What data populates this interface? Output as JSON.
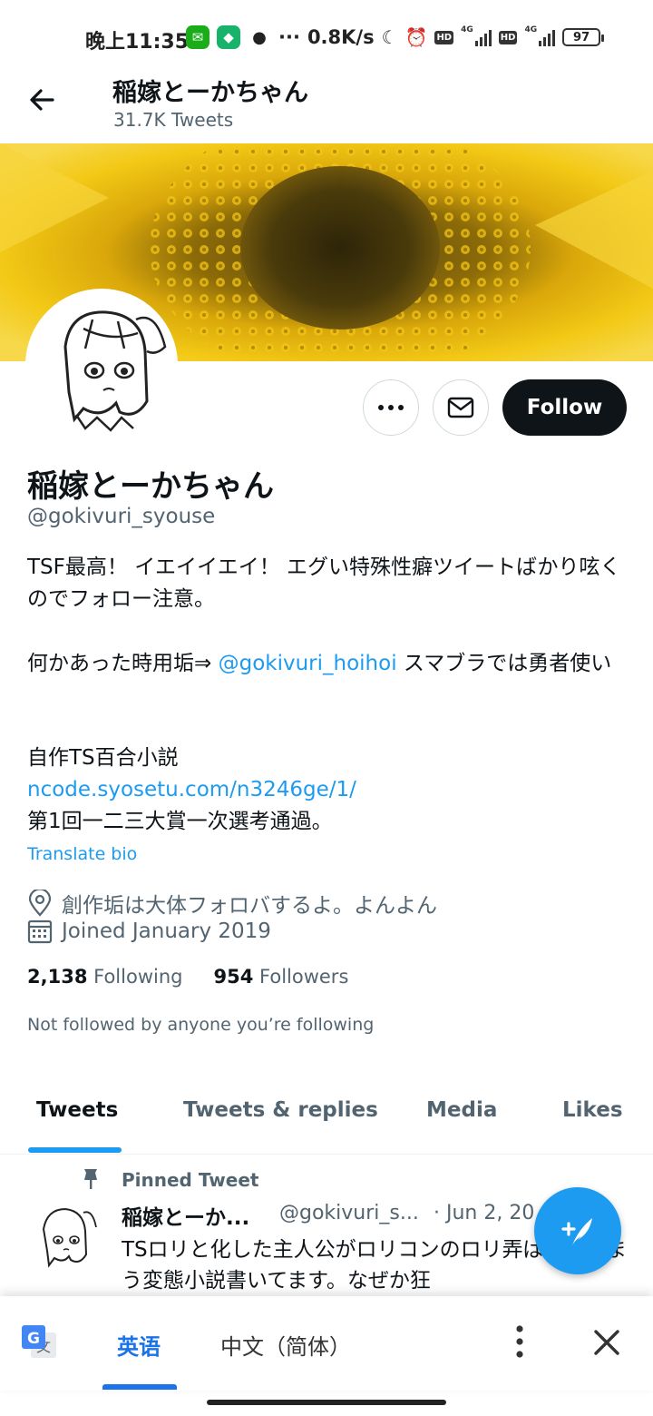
{
  "status_bar": {
    "time": "晚上11:35",
    "overflow": "···",
    "speed": "0.8K/s",
    "hd1": "HD",
    "hd2": "HD",
    "net1": "4G",
    "net2": "4G",
    "battery": "97"
  },
  "header": {
    "name": "稲嫁とーかちゃん",
    "tweet_count": "31.7K Tweets"
  },
  "profile": {
    "follow_label": "Follow",
    "name": "稲嫁とーかちゃん",
    "handle": "@gokivuri_syouse",
    "bio_line1": "TSF最高！ イエイイエイ！ エグい特殊性癖ツイートばかり呟くのでフォロー注意。",
    "bio_line2_prefix": "何かあった時用垢⇒ ",
    "bio_line2_link": "@gokivuri_hoihoi",
    "bio_line2_suffix": " スマブラでは勇者使い",
    "bio_line3": "自作TS百合小説",
    "bio_line3_link": "ncode.syosetu.com/n3246ge/1/",
    "bio_line4": "第1回一二三大賞一次選考通過。",
    "translate_bio": "Translate bio",
    "location": "創作垢は大体フォロバするよ。よんよん",
    "joined": "Joined January 2019",
    "following_count": "2,138",
    "following_label": "Following",
    "followers_count": "954",
    "followers_label": "Followers",
    "not_followed": "Not followed by anyone you’re following"
  },
  "tabs": [
    {
      "label": "Tweets",
      "active": true
    },
    {
      "label": "Tweets & replies",
      "active": false
    },
    {
      "label": "Media",
      "active": false
    },
    {
      "label": "Likes",
      "active": false
    }
  ],
  "pinned_tweet": {
    "label": "Pinned Tweet",
    "name": "稲嫁とーか...",
    "handle": "@gokivuri_s...",
    "date": "· Jun 2, 20",
    "text": "TSロリと化した主人公がロリコンのロリ弄ばれてしまう変態小説書いてます。なぜか狂"
  },
  "translate_bar": {
    "lang_source": "英语",
    "lang_target": "中文（简体）"
  },
  "colors": {
    "accent": "#1d9bf0",
    "follow_bg": "#0f1419",
    "translate_accent": "#1a73e8"
  },
  "icons": [
    "back-arrow-icon",
    "more-icon",
    "mail-icon",
    "location-icon",
    "calendar-icon",
    "pin-icon",
    "compose-icon",
    "google-translate-icon",
    "overflow-menu-icon",
    "close-icon"
  ]
}
